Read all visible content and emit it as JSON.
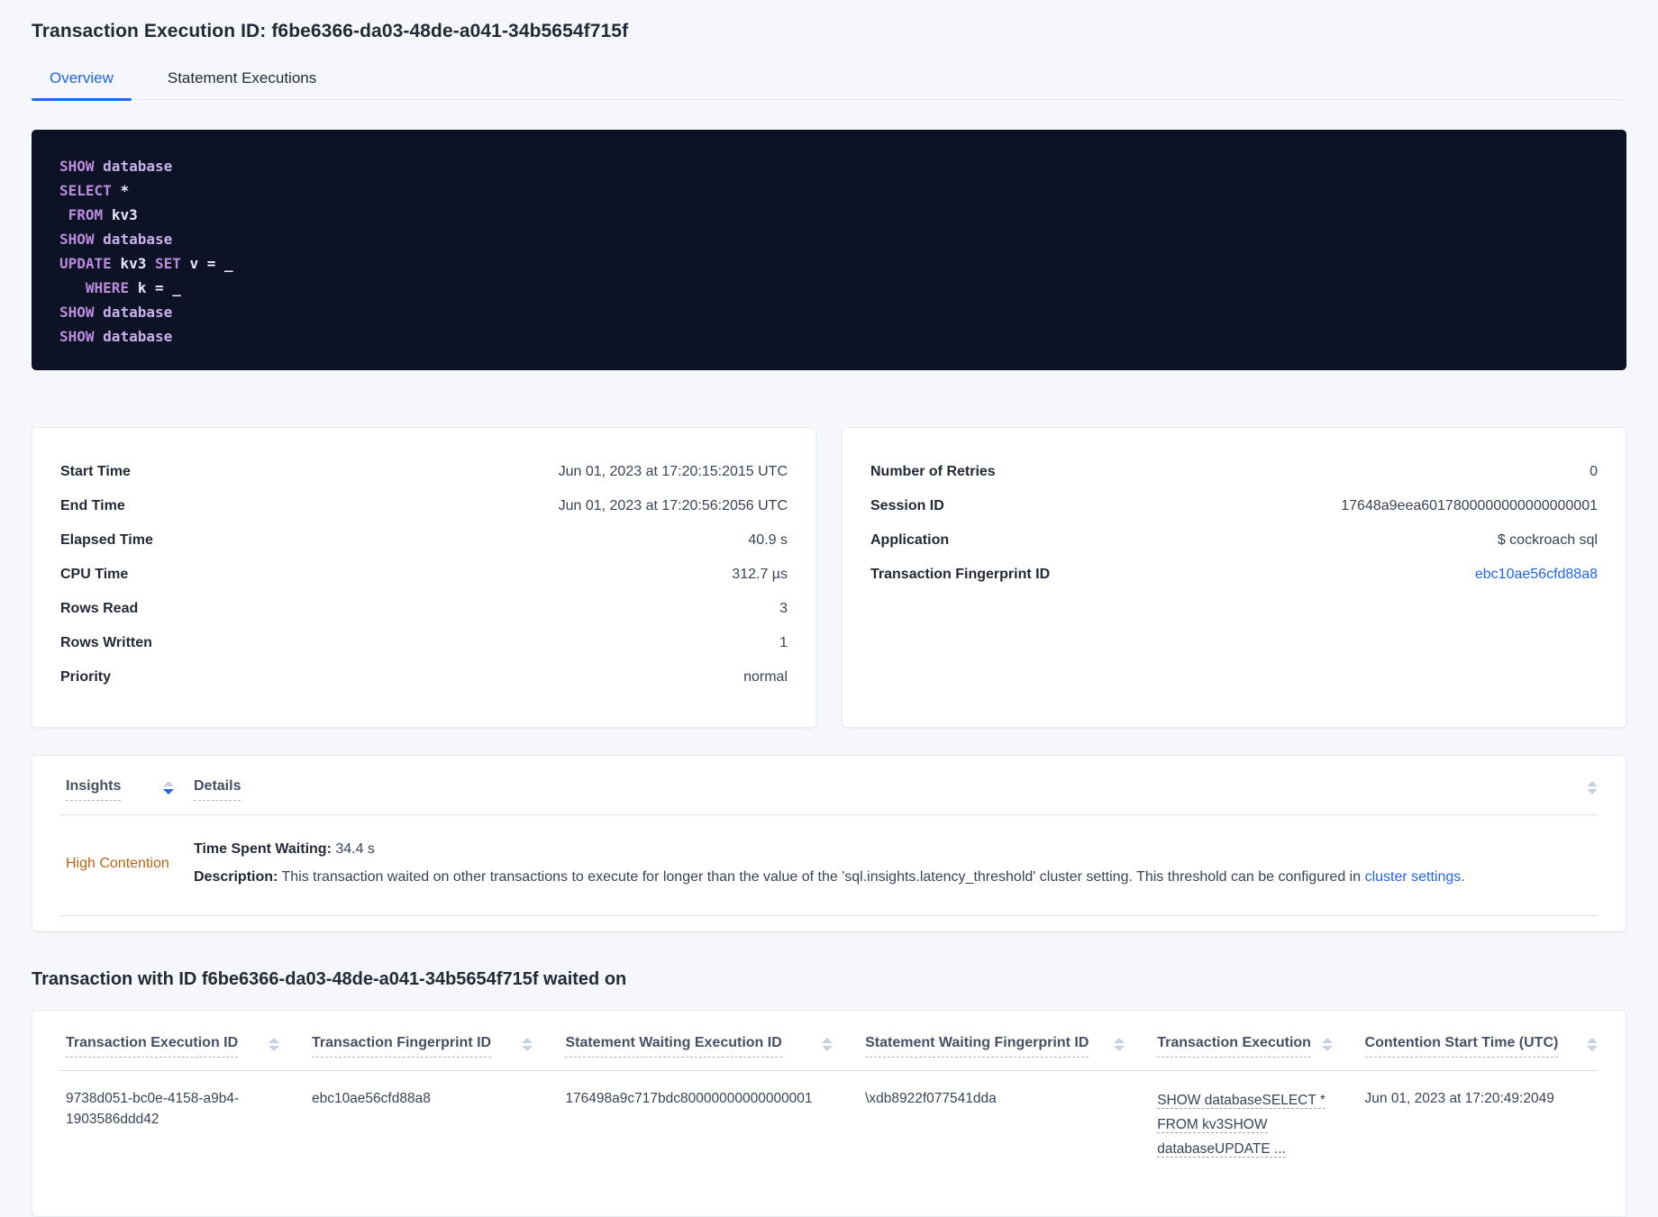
{
  "colors": {
    "accent_blue": "#1f66eb",
    "warning_orange": "#bd6414",
    "code_background": "#0d1324",
    "sql_keyword": "#ba8cde",
    "page_background": "#f5f7fa"
  },
  "header": {
    "title": "Transaction Execution ID: f6be6366-da03-48de-a041-34b5654f715f"
  },
  "tabs": {
    "overview": "Overview",
    "statement_executions": "Statement Executions"
  },
  "sql_box": {
    "lines": [
      [
        {
          "t": "SHOW ",
          "c": "kw"
        },
        {
          "t": "database",
          "c": "id"
        }
      ],
      [
        {
          "t": "SELECT ",
          "c": "kw"
        },
        {
          "t": "*",
          "c": "pl"
        }
      ],
      [
        {
          "t": " ",
          "c": "pl"
        },
        {
          "t": "FROM ",
          "c": "kw"
        },
        {
          "t": "kv3",
          "c": "pl"
        }
      ],
      [
        {
          "t": "SHOW ",
          "c": "kw"
        },
        {
          "t": "database",
          "c": "id"
        }
      ],
      [
        {
          "t": "UPDATE ",
          "c": "kw"
        },
        {
          "t": "kv3 ",
          "c": "pl"
        },
        {
          "t": "SET ",
          "c": "kw"
        },
        {
          "t": "v = _",
          "c": "pl"
        }
      ],
      [
        {
          "t": "   ",
          "c": "pl"
        },
        {
          "t": "WHERE ",
          "c": "kw"
        },
        {
          "t": "k = _",
          "c": "pl"
        }
      ],
      [
        {
          "t": "SHOW ",
          "c": "kw"
        },
        {
          "t": "database",
          "c": "id"
        }
      ],
      [
        {
          "t": "SHOW ",
          "c": "kw"
        },
        {
          "t": "database",
          "c": "id"
        }
      ]
    ]
  },
  "details_card": {
    "rows": [
      {
        "label": "Start Time",
        "value": "Jun 01, 2023 at 17:20:15:2015 UTC"
      },
      {
        "label": "End Time",
        "value": "Jun 01, 2023 at 17:20:56:2056 UTC"
      },
      {
        "label": "Elapsed Time",
        "value": "40.9 s"
      },
      {
        "label": "CPU Time",
        "value": "312.7 µs"
      },
      {
        "label": "Rows Read",
        "value": "3"
      },
      {
        "label": "Rows Written",
        "value": "1"
      },
      {
        "label": "Priority",
        "value": "normal"
      }
    ]
  },
  "meta_card": {
    "rows": [
      {
        "label": "Number of Retries",
        "value": "0"
      },
      {
        "label": "Session ID",
        "value": "17648a9eea6017800000000000000001"
      },
      {
        "label": "Application",
        "value": "$ cockroach sql"
      },
      {
        "label": "Transaction Fingerprint ID",
        "value": "ebc10ae56cfd88a8"
      }
    ]
  },
  "insights_table": {
    "headers": {
      "insights": "Insights",
      "details": "Details"
    },
    "row": {
      "insight": "High Contention",
      "waiting_label": "Time Spent Waiting:",
      "waiting_value": " 34.4 s",
      "description_label": "Description:",
      "description_text": " This transaction waited on other transactions to execute for longer than the value of the 'sql.insights.latency_threshold' cluster setting. This threshold can be configured in ",
      "description_link": "cluster settings",
      "description_suffix": "."
    }
  },
  "waited_section": {
    "title": "Transaction with ID f6be6366-da03-48de-a041-34b5654f715f waited on",
    "columns": [
      "Transaction Execution ID",
      "Transaction Fingerprint ID",
      "Statement Waiting Execution ID",
      "Statement Waiting Fingerprint ID",
      "Transaction Execution",
      "Contention Start Time (UTC)"
    ],
    "row": {
      "transaction_execution_id": "9738d051-bc0e-4158-a9b4-1903586ddd42",
      "transaction_fingerprint_id": "ebc10ae56cfd88a8",
      "statement_waiting_execution_id": "176498a9c717bdc80000000000000001",
      "statement_waiting_fingerprint_id": "\\xdb8922f077541dda",
      "transaction_execution": "SHOW databaseSELECT * FROM kv3SHOW databaseUPDATE ...",
      "contention_start_time": "Jun 01, 2023 at 17:20:49:2049"
    }
  }
}
